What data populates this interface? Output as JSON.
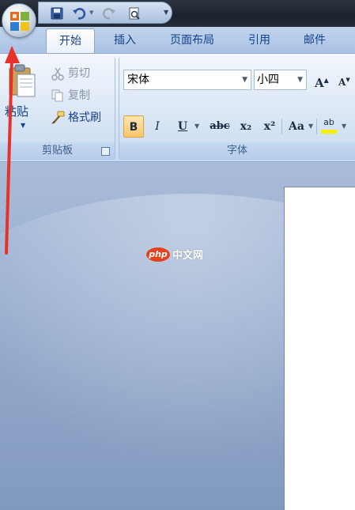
{
  "tabs": [
    {
      "label": "开始",
      "active": true
    },
    {
      "label": "插入",
      "active": false
    },
    {
      "label": "页面布局",
      "active": false
    },
    {
      "label": "引用",
      "active": false
    },
    {
      "label": "邮件",
      "active": false
    }
  ],
  "clipboard": {
    "paste_label": "粘贴",
    "cut_label": "剪切",
    "copy_label": "复制",
    "format_painter_label": "格式刷",
    "group_label": "剪贴板"
  },
  "font": {
    "font_name": "宋体",
    "font_size": "小四",
    "grow_label": "A",
    "shrink_label": "A",
    "bold_label": "B",
    "italic_label": "I",
    "underline_label": "U",
    "strike_label": "abc",
    "subscript_label": "x₂",
    "superscript_label": "x²",
    "case_label": "Aa",
    "highlight_label": "ab",
    "group_label": "字体"
  },
  "watermark": {
    "badge": "php",
    "text": "中文网"
  },
  "colors": {
    "accent": "#15428b",
    "arrow": "#e8312a",
    "bold_active": "#f9c66a"
  }
}
